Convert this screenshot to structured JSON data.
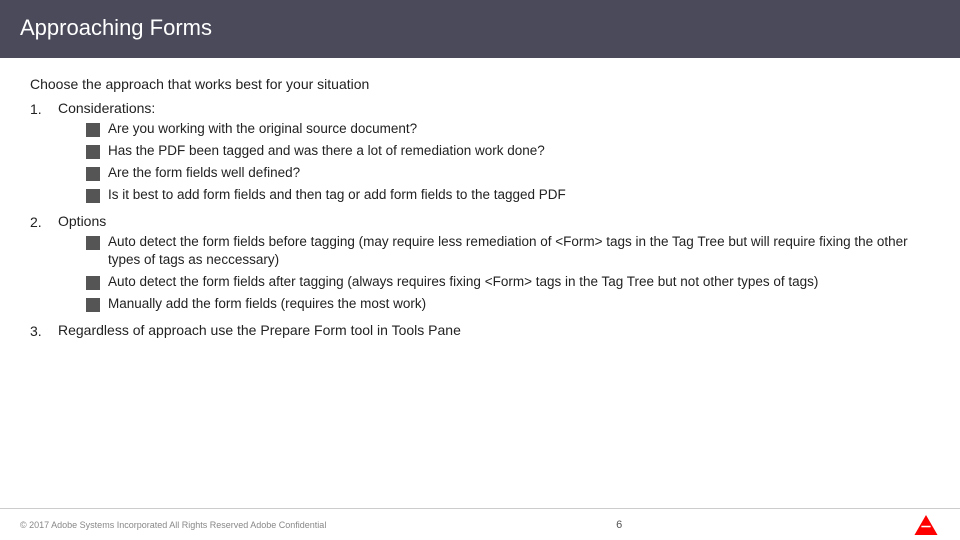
{
  "header": {
    "title": "Approaching Forms"
  },
  "content": {
    "intro": "Choose the approach that works best for your situation",
    "items": [
      {
        "number": "1.",
        "label": "Considerations:",
        "bullets": [
          "Are you working with the original source document?",
          "Has the PDF been tagged and was there a lot of remediation work done?",
          "Are the form fields well defined?",
          "Is it best to add form fields and then tag or add form fields to the tagged PDF"
        ]
      },
      {
        "number": "2.",
        "label": "Options",
        "bullets": [
          "Auto detect the form fields before tagging (may require less remediation of <Form> tags in the Tag Tree but will require fixing the other types of tags as neccessary)",
          "Auto detect the form fields after tagging (always requires fixing <Form> tags in the Tag Tree but not other types of tags)",
          "Manually add the form fields (requires the most work)"
        ]
      },
      {
        "number": "3.",
        "label": "Regardless of approach use the Prepare Form tool in Tools Pane",
        "bullets": []
      }
    ]
  },
  "footer": {
    "copyright": "© 2017 Adobe Systems Incorporated  All Rights Reserved  Adobe Confidential",
    "page_number": "6"
  }
}
